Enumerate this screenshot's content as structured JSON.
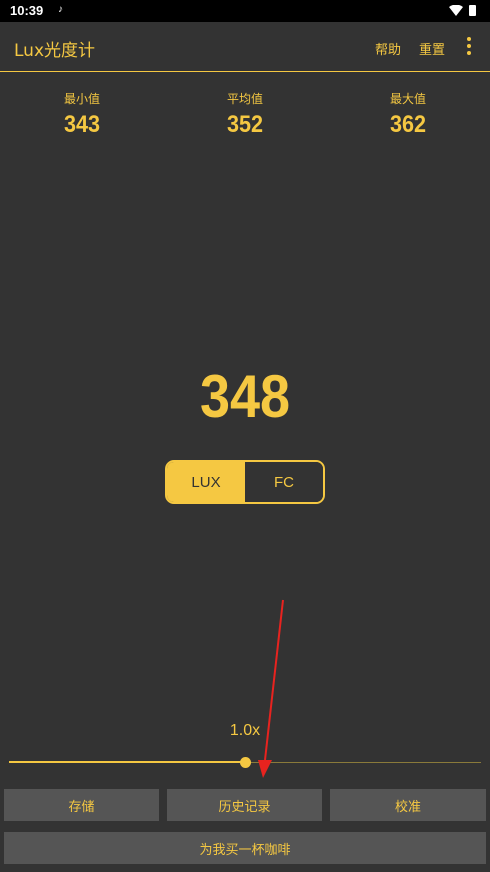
{
  "status_bar": {
    "time": "10:39",
    "notification_icon": "note-icon",
    "wifi_icon": "wifi-icon",
    "battery_icon": "battery-icon"
  },
  "app_bar": {
    "title": "Lux光度计",
    "help": "帮助",
    "reset": "重置",
    "more_icon": "more-vert-icon"
  },
  "stats": {
    "min": {
      "label": "最小值",
      "value": "343"
    },
    "avg": {
      "label": "平均值",
      "value": "352"
    },
    "max": {
      "label": "最大值",
      "value": "362"
    }
  },
  "reading": "348",
  "units": {
    "lux": "LUX",
    "fc": "FC",
    "selected": "LUX"
  },
  "zoom": {
    "label": "1.0x",
    "position_fraction": 0.5
  },
  "buttons": {
    "save": "存储",
    "history": "历史记录",
    "calibrate": "校准",
    "coffee": "为我买一杯咖啡"
  },
  "colors": {
    "accent": "#f5c842",
    "background": "#333333",
    "button_bg": "#555555",
    "annotation_arrow": "#e8231f"
  }
}
